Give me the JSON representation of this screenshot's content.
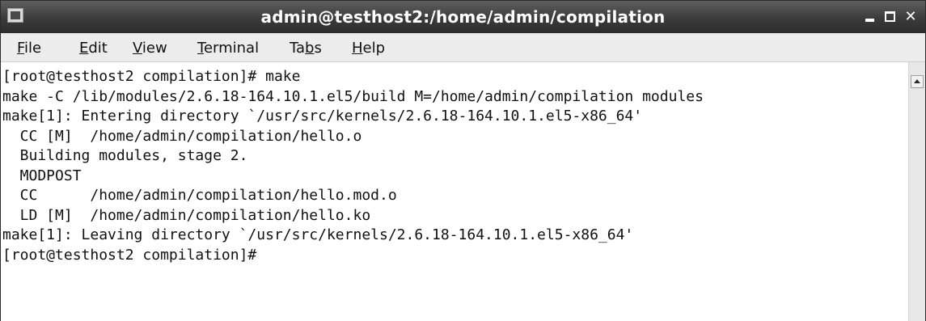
{
  "window": {
    "title": "admin@testhost2:/home/admin/compilation",
    "controls": {
      "minimize_icon": "minimize-icon",
      "maximize_icon": "maximize-icon",
      "close_label": "✕"
    }
  },
  "menu": {
    "items": [
      {
        "mnemonic": "F",
        "rest": "ile"
      },
      {
        "mnemonic": "E",
        "rest": "dit"
      },
      {
        "mnemonic": "V",
        "rest": "iew"
      },
      {
        "mnemonic": "T",
        "rest": "erminal"
      },
      {
        "pre": "Ta",
        "mnemonic": "b",
        "rest": "s"
      },
      {
        "mnemonic": "H",
        "rest": "elp"
      }
    ]
  },
  "terminal": {
    "lines": [
      "[root@testhost2 compilation]# make",
      "make -C /lib/modules/2.6.18-164.10.1.el5/build M=/home/admin/compilation modules",
      "make[1]: Entering directory `/usr/src/kernels/2.6.18-164.10.1.el5-x86_64'",
      "  CC [M]  /home/admin/compilation/hello.o",
      "  Building modules, stage 2.",
      "  MODPOST",
      "  CC      /home/admin/compilation/hello.mod.o",
      "  LD [M]  /home/admin/compilation/hello.ko",
      "make[1]: Leaving directory `/usr/src/kernels/2.6.18-164.10.1.el5-x86_64'",
      "[root@testhost2 compilation]#"
    ]
  },
  "scrollbar": {
    "up_icon": "arrow-up-icon"
  },
  "colors": {
    "titlebar": "#3b3b3b",
    "menubar": "#ececec",
    "terminal_bg": "#ffffff",
    "terminal_fg": "#111111"
  }
}
